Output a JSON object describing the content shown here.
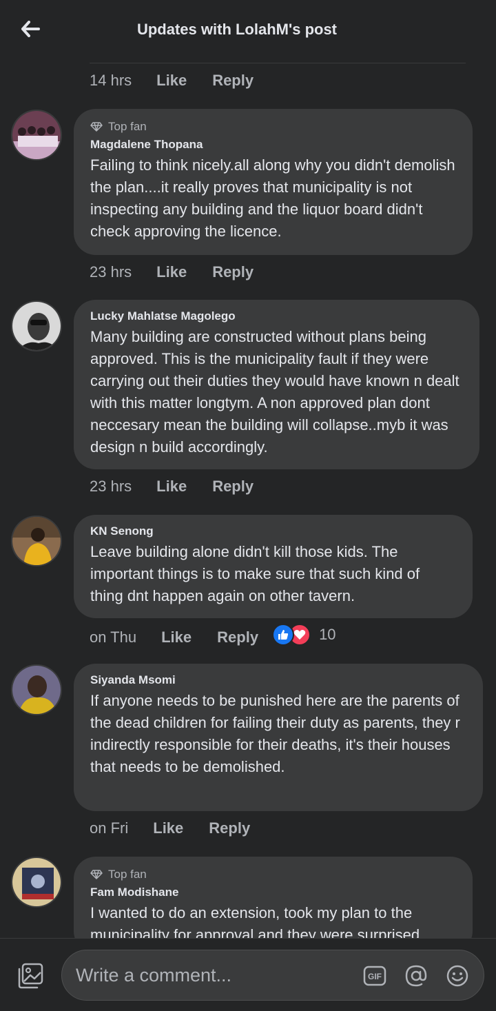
{
  "header": {
    "title": "Updates with LolahM's post"
  },
  "first_actions": {
    "time": "14 hrs",
    "like": "Like",
    "reply": "Reply"
  },
  "comments": [
    {
      "badge": "Top fan",
      "author": "Magdalene Thopana",
      "text": "Failing to think nicely.all along why you didn't demolish the plan....it really proves that municipality is not inspecting any building and the liquor board didn't check approving the licence.",
      "time": "23 hrs",
      "like": "Like",
      "reply": "Reply"
    },
    {
      "author": "Lucky Mahlatse Magolego",
      "text": "Many building are constructed without plans being approved. This is the municipality fault if they were carrying out their duties they would have known n dealt with this matter longtym. A non approved plan dont neccesary mean the building will collapse..myb it was design n build accordingly.",
      "time": "23 hrs",
      "like": "Like",
      "reply": "Reply"
    },
    {
      "author": "KN Senong",
      "text": "Leave building alone didn't kill those kids. The important things is to make sure that such kind of thing dnt happen again on other tavern.",
      "time": "on Thu",
      "like": "Like",
      "reply": "Reply",
      "reaction_count": "10"
    },
    {
      "author": "Siyanda Msomi",
      "text": "If anyone needs to be punished here are the parents of the dead children for failing their duty as parents, they r indirectly responsible for their deaths, it's their houses that needs to be demolished.",
      "time": "on Fri",
      "like": "Like",
      "reply": "Reply"
    },
    {
      "badge": "Top fan",
      "author": "Fam Modishane",
      "text": "I wanted to do an extension, took my plan to the municipality for approval and they were surprised"
    }
  ],
  "composer": {
    "placeholder": "Write a comment..."
  },
  "colors": {
    "background": "#242526",
    "bubble": "#3a3b3c",
    "like_blue": "#1877f2",
    "love_red": "#f33e58"
  }
}
